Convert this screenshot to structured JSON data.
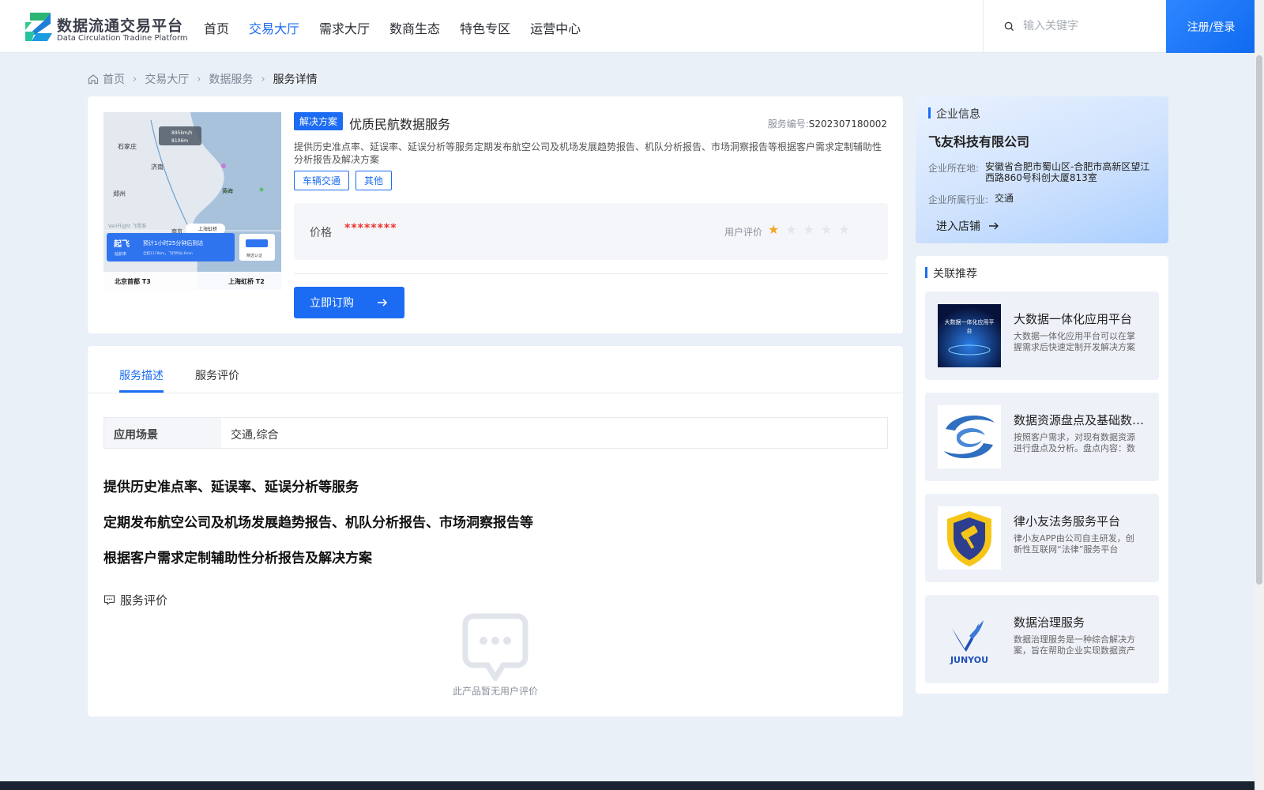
{
  "header": {
    "logo_title": "数据流通交易平台",
    "logo_subtitle": "Data Circulation Tradine Platform",
    "nav": [
      {
        "label": "首页",
        "active": false
      },
      {
        "label": "交易大厅",
        "active": true
      },
      {
        "label": "需求大厅",
        "active": false
      },
      {
        "label": "数商生态",
        "active": false
      },
      {
        "label": "特色专区",
        "active": false
      },
      {
        "label": "运营中心",
        "active": false
      }
    ],
    "search_placeholder": "输入关键字",
    "login_label": "注册/登录",
    "accent_color": "#1b6cf2"
  },
  "breadcrumb": {
    "items": [
      "首页",
      "交易大厅",
      "数据服务",
      "服务详情"
    ]
  },
  "product": {
    "type_tag": "解决方案",
    "title": "优质民航数据服务",
    "service_no_label": "服务编号:",
    "service_no": "S202307180002",
    "description": "提供历史准点率、延误率、延误分析等服务定期发布航空公司及机场发展趋势报告、机队分析报告、市场洞察报告等根据客户需求定制辅助性分析报告及解决方案",
    "tags": [
      "车辆交通",
      "其他"
    ],
    "price_label": "价格",
    "price_value": "********",
    "rating_label": "用户评价",
    "rating": 1,
    "rating_max": 5,
    "order_label": "立即订购",
    "image": {
      "map_cities": [
        "石家庄",
        "济南",
        "郑州",
        "黄海",
        "南京",
        "上海虹桥"
      ],
      "flight_badge_title": "起飞",
      "flight_badge_sub": "延航率",
      "flight_text": "预计1小时25分钟后到达",
      "flight_subtext": "全程1178km，飞行时长:6min",
      "certified_label": "精选认证",
      "from_terminal": "北京首都 T3",
      "to_terminal": "上海虹桥 T2",
      "chip_line1": "895km/h",
      "chip_line2": "8106m",
      "watermark": "VariFlight 飞常准",
      "route_label": "上海虹桥"
    }
  },
  "tabs": {
    "items": [
      "服务描述",
      "服务评价"
    ],
    "active": 0
  },
  "details": {
    "scene_key": "应用场景",
    "scene_value": "交通,综合",
    "features": [
      "提供历史准点率、延误率、延误分析等服务",
      "定期发布航空公司及机场发展趋势报告、机队分析报告、市场洞察报告等",
      "根据客户需求定制辅助性分析报告及解决方案"
    ],
    "review_title": "服务评价",
    "empty_review": "此产品暂无用户评价"
  },
  "company": {
    "section_title": "企业信息",
    "name": "飞友科技有限公司",
    "location_label": "企业所在地:",
    "location": "安徽省合肥市蜀山区-合肥市高新区望江西路860号科创大厦813室",
    "industry_label": "企业所属行业:",
    "industry": "交通",
    "enter_shop": "进入店铺"
  },
  "related": {
    "section_title": "关联推荐",
    "items": [
      {
        "title": "大数据一体化应用平台",
        "desc": "大数据一体化应用平台可以在掌握需求后快速定制开发解决方案",
        "thumb_text": "大数据一体化应用平台",
        "thumb": "bigdata"
      },
      {
        "title": "数据资源盘点及基础数据治理",
        "desc": "按照客户需求，对现有数据资源进行盘点及分析。盘点内容：数据资源",
        "thumb": "swirl"
      },
      {
        "title": "律小友法务服务平台",
        "desc": "律小友APP由公司自主研发，创新性互联网“法律”服务平台",
        "thumb": "badge"
      },
      {
        "title": "数据治理服务",
        "desc": "数据治理服务是一种综合解决方案，旨在帮助企业实现数据资产管理",
        "thumb_text": "JUNYOU",
        "thumb": "junyou"
      }
    ]
  }
}
